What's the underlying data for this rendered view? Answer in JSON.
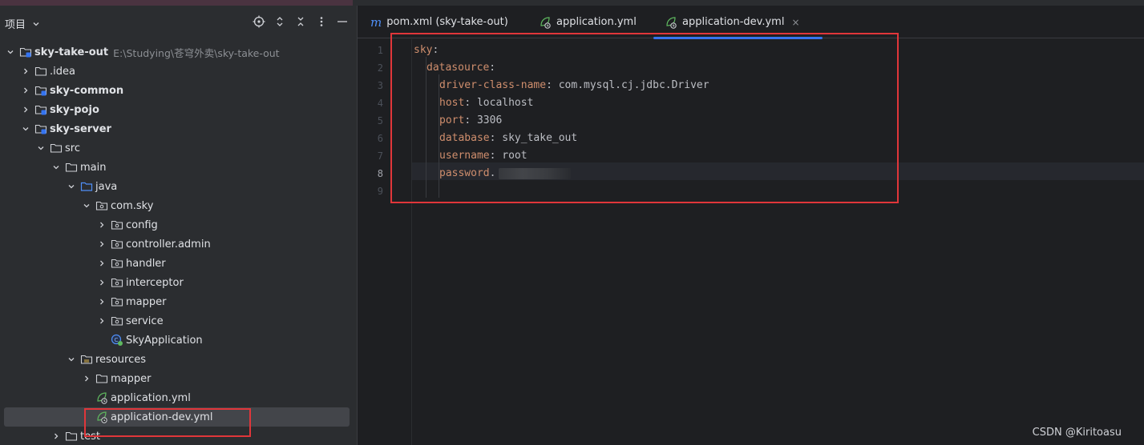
{
  "panel": {
    "title": "项目",
    "tools": [
      "locate-icon",
      "expand-collapse-icon",
      "collapse-all-icon",
      "more-icon",
      "minimize-icon"
    ]
  },
  "tree": [
    {
      "label": "sky-take-out",
      "hint": "E:\\Studying\\苍穹外卖\\sky-take-out",
      "depth": 0,
      "arrow": "down",
      "icon": "module",
      "bold": true
    },
    {
      "label": ".idea",
      "depth": 1,
      "arrow": "right",
      "icon": "folder"
    },
    {
      "label": "sky-common",
      "depth": 1,
      "arrow": "right",
      "icon": "module",
      "bold": true
    },
    {
      "label": "sky-pojo",
      "depth": 1,
      "arrow": "right",
      "icon": "module",
      "bold": true
    },
    {
      "label": "sky-server",
      "depth": 1,
      "arrow": "down",
      "icon": "module",
      "bold": true
    },
    {
      "label": "src",
      "depth": 2,
      "arrow": "down",
      "icon": "folder"
    },
    {
      "label": "main",
      "depth": 3,
      "arrow": "down",
      "icon": "folder"
    },
    {
      "label": "java",
      "depth": 4,
      "arrow": "down",
      "icon": "source-folder"
    },
    {
      "label": "com.sky",
      "depth": 5,
      "arrow": "down",
      "icon": "package"
    },
    {
      "label": "config",
      "depth": 6,
      "arrow": "right",
      "icon": "package"
    },
    {
      "label": "controller.admin",
      "depth": 6,
      "arrow": "right",
      "icon": "package"
    },
    {
      "label": "handler",
      "depth": 6,
      "arrow": "right",
      "icon": "package"
    },
    {
      "label": "interceptor",
      "depth": 6,
      "arrow": "right",
      "icon": "package"
    },
    {
      "label": "mapper",
      "depth": 6,
      "arrow": "right",
      "icon": "package"
    },
    {
      "label": "service",
      "depth": 6,
      "arrow": "right",
      "icon": "package"
    },
    {
      "label": "SkyApplication",
      "depth": 6,
      "arrow": "none",
      "icon": "spring-class"
    },
    {
      "label": "resources",
      "depth": 4,
      "arrow": "down",
      "icon": "resources-folder"
    },
    {
      "label": "mapper",
      "depth": 5,
      "arrow": "right",
      "icon": "folder"
    },
    {
      "label": "application.yml",
      "depth": 5,
      "arrow": "none",
      "icon": "yaml"
    },
    {
      "label": "application-dev.yml",
      "depth": 5,
      "arrow": "none",
      "icon": "yaml",
      "selected": true
    },
    {
      "label": "test",
      "depth": 3,
      "arrow": "right",
      "icon": "folder"
    }
  ],
  "tabs": [
    {
      "label": "pom.xml (sky-take-out)",
      "icon": "maven"
    },
    {
      "label": "application.yml",
      "icon": "yaml"
    },
    {
      "label": "application-dev.yml",
      "icon": "yaml",
      "active": true,
      "close": "×"
    }
  ],
  "editor": {
    "current_line": 8,
    "lines": [
      {
        "n": "1",
        "key": "sky",
        "value": ""
      },
      {
        "n": "2",
        "key": "datasource",
        "value": ""
      },
      {
        "n": "3",
        "key": "driver-class-name",
        "value": "com.mysql.cj.jdbc.Driver"
      },
      {
        "n": "4",
        "key": "host",
        "value": "localhost"
      },
      {
        "n": "5",
        "key": "port",
        "value": "3306"
      },
      {
        "n": "6",
        "key": "database",
        "value": "sky_take_out"
      },
      {
        "n": "7",
        "key": "username",
        "value": "root"
      },
      {
        "n": "8",
        "key": "password",
        "value": "",
        "redacted": true
      },
      {
        "n": "9",
        "key": "",
        "value": ""
      }
    ]
  },
  "watermark": "CSDN @Kiritoasu",
  "colors": {
    "accent": "#3574f0",
    "annotation": "#e0363a",
    "yaml_key": "#cf8e6d"
  }
}
